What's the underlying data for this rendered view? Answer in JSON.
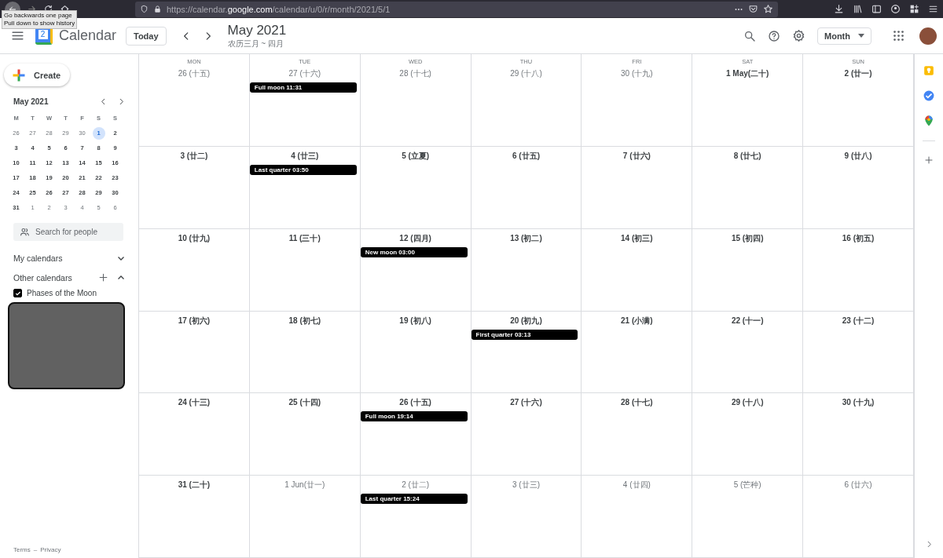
{
  "browser": {
    "url": "https://calendar.**google.com**/calendar/u/0/r/month/2021/5/1",
    "tooltip": [
      "Go backwards one page",
      "Pull down to show history"
    ]
  },
  "header": {
    "logo_day": "2",
    "app_name": "Calendar",
    "today_button": "Today",
    "title": "May 2021",
    "subtitle": "农历三月 ~ 四月",
    "view_dropdown": "Month"
  },
  "sidebar": {
    "create_button": "Create",
    "mini_calendar": {
      "title": "May 2021",
      "weekdays": [
        "M",
        "T",
        "W",
        "T",
        "F",
        "S",
        "S"
      ],
      "days": [
        {
          "label": "26",
          "in_month": false,
          "selected": false
        },
        {
          "label": "27",
          "in_month": false,
          "selected": false
        },
        {
          "label": "28",
          "in_month": false,
          "selected": false
        },
        {
          "label": "29",
          "in_month": false,
          "selected": false
        },
        {
          "label": "30",
          "in_month": false,
          "selected": false
        },
        {
          "label": "1",
          "in_month": true,
          "selected": true
        },
        {
          "label": "2",
          "in_month": true,
          "selected": false
        },
        {
          "label": "3",
          "in_month": true,
          "selected": false
        },
        {
          "label": "4",
          "in_month": true,
          "selected": false
        },
        {
          "label": "5",
          "in_month": true,
          "selected": false
        },
        {
          "label": "6",
          "in_month": true,
          "selected": false
        },
        {
          "label": "7",
          "in_month": true,
          "selected": false
        },
        {
          "label": "8",
          "in_month": true,
          "selected": false
        },
        {
          "label": "9",
          "in_month": true,
          "selected": false
        },
        {
          "label": "10",
          "in_month": true,
          "selected": false
        },
        {
          "label": "11",
          "in_month": true,
          "selected": false
        },
        {
          "label": "12",
          "in_month": true,
          "selected": false
        },
        {
          "label": "13",
          "in_month": true,
          "selected": false
        },
        {
          "label": "14",
          "in_month": true,
          "selected": false
        },
        {
          "label": "15",
          "in_month": true,
          "selected": false
        },
        {
          "label": "16",
          "in_month": true,
          "selected": false
        },
        {
          "label": "17",
          "in_month": true,
          "selected": false
        },
        {
          "label": "18",
          "in_month": true,
          "selected": false
        },
        {
          "label": "19",
          "in_month": true,
          "selected": false
        },
        {
          "label": "20",
          "in_month": true,
          "selected": false
        },
        {
          "label": "21",
          "in_month": true,
          "selected": false
        },
        {
          "label": "22",
          "in_month": true,
          "selected": false
        },
        {
          "label": "23",
          "in_month": true,
          "selected": false
        },
        {
          "label": "24",
          "in_month": true,
          "selected": false
        },
        {
          "label": "25",
          "in_month": true,
          "selected": false
        },
        {
          "label": "26",
          "in_month": true,
          "selected": false
        },
        {
          "label": "27",
          "in_month": true,
          "selected": false
        },
        {
          "label": "28",
          "in_month": true,
          "selected": false
        },
        {
          "label": "29",
          "in_month": true,
          "selected": false
        },
        {
          "label": "30",
          "in_month": true,
          "selected": false
        },
        {
          "label": "31",
          "in_month": true,
          "selected": false
        },
        {
          "label": "1",
          "in_month": false,
          "selected": false
        },
        {
          "label": "2",
          "in_month": false,
          "selected": false
        },
        {
          "label": "3",
          "in_month": false,
          "selected": false
        },
        {
          "label": "4",
          "in_month": false,
          "selected": false
        },
        {
          "label": "5",
          "in_month": false,
          "selected": false
        },
        {
          "label": "6",
          "in_month": false,
          "selected": false
        }
      ]
    },
    "search_people": {
      "placeholder": "Search for people"
    },
    "my_calendars": {
      "label": "My calendars",
      "expanded": false
    },
    "other_calendars": {
      "label": "Other calendars",
      "expanded": true,
      "items": [
        {
          "label": "Phases of the Moon",
          "checked": true
        }
      ]
    },
    "footer": {
      "terms": "Terms",
      "separator": "–",
      "privacy": "Privacy"
    }
  },
  "month_grid": {
    "weekdays": [
      "MON",
      "TUE",
      "WED",
      "THU",
      "FRI",
      "SAT",
      "SUN"
    ],
    "weeks": [
      {
        "cells": [
          {
            "date": "26 (十五)",
            "in_month": false
          },
          {
            "date": "27 (十六)",
            "in_month": false,
            "events": [
              "Full moon 11:31"
            ]
          },
          {
            "date": "28 (十七)",
            "in_month": false
          },
          {
            "date": "29 (十八)",
            "in_month": false
          },
          {
            "date": "30 (十九)",
            "in_month": false
          },
          {
            "date": "1 May(二十)",
            "in_month": true
          },
          {
            "date": "2 (廿一)",
            "in_month": true
          }
        ]
      },
      {
        "cells": [
          {
            "date": "3 (廿二)",
            "in_month": true
          },
          {
            "date": "4 (廿三)",
            "in_month": true,
            "events": [
              "Last quarter 03:50"
            ]
          },
          {
            "date": "5 (立夏)",
            "in_month": true
          },
          {
            "date": "6 (廿五)",
            "in_month": true
          },
          {
            "date": "7 (廿六)",
            "in_month": true
          },
          {
            "date": "8 (廿七)",
            "in_month": true
          },
          {
            "date": "9 (廿八)",
            "in_month": true
          }
        ]
      },
      {
        "cells": [
          {
            "date": "10 (廿九)",
            "in_month": true
          },
          {
            "date": "11 (三十)",
            "in_month": true
          },
          {
            "date": "12 (四月)",
            "in_month": true,
            "events": [
              "New moon 03:00"
            ]
          },
          {
            "date": "13 (初二)",
            "in_month": true
          },
          {
            "date": "14 (初三)",
            "in_month": true
          },
          {
            "date": "15 (初四)",
            "in_month": true
          },
          {
            "date": "16 (初五)",
            "in_month": true
          }
        ]
      },
      {
        "cells": [
          {
            "date": "17 (初六)",
            "in_month": true
          },
          {
            "date": "18 (初七)",
            "in_month": true
          },
          {
            "date": "19 (初八)",
            "in_month": true
          },
          {
            "date": "20 (初九)",
            "in_month": true,
            "events": [
              "First quarter 03:13"
            ]
          },
          {
            "date": "21 (小满)",
            "in_month": true
          },
          {
            "date": "22 (十一)",
            "in_month": true
          },
          {
            "date": "23 (十二)",
            "in_month": true
          }
        ]
      },
      {
        "cells": [
          {
            "date": "24 (十三)",
            "in_month": true
          },
          {
            "date": "25 (十四)",
            "in_month": true
          },
          {
            "date": "26 (十五)",
            "in_month": true,
            "events": [
              "Full moon 19:14"
            ]
          },
          {
            "date": "27 (十六)",
            "in_month": true
          },
          {
            "date": "28 (十七)",
            "in_month": true
          },
          {
            "date": "29 (十八)",
            "in_month": true
          },
          {
            "date": "30 (十九)",
            "in_month": true
          }
        ]
      },
      {
        "cells": [
          {
            "date": "31 (二十)",
            "in_month": true
          },
          {
            "date": "1 Jun(廿一)",
            "in_month": false
          },
          {
            "date": "2 (廿二)",
            "in_month": false,
            "events": [
              "Last quarter 15:24"
            ]
          },
          {
            "date": "3 (廿三)",
            "in_month": false
          },
          {
            "date": "4 (廿四)",
            "in_month": false
          },
          {
            "date": "5 (芒种)",
            "in_month": false
          },
          {
            "date": "6 (廿六)",
            "in_month": false
          }
        ]
      }
    ]
  }
}
